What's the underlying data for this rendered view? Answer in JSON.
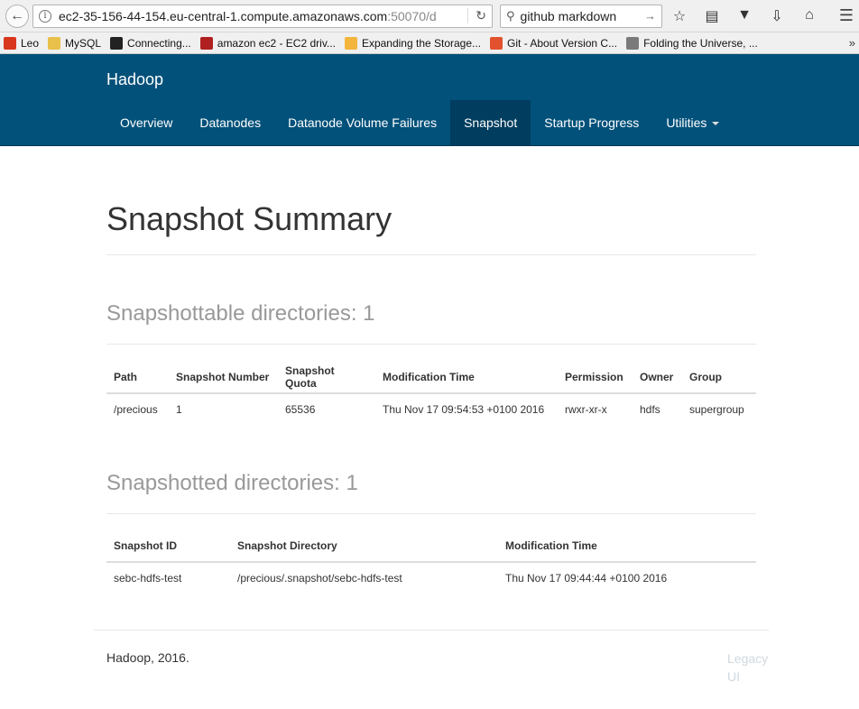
{
  "browser": {
    "url_host": "ec2-35-156-44-154.eu-central-1.compute.amazonaws.com",
    "url_rest": ":50070/d",
    "search_text": "github markdown",
    "bookmarks": [
      {
        "label": "Leo",
        "color": "#d9361e"
      },
      {
        "label": "MySQL",
        "color": "#e8c04a"
      },
      {
        "label": "Connecting...",
        "color": "#222222"
      },
      {
        "label": "amazon ec2 - EC2 driv...",
        "color": "#b02020"
      },
      {
        "label": "Expanding the Storage...",
        "color": "#f3b53b"
      },
      {
        "label": "Git - About Version C...",
        "color": "#e2522f"
      },
      {
        "label": "Folding the Universe, ...",
        "color": "#7a7a7a"
      }
    ],
    "bookmarks_more": "»"
  },
  "navbar": {
    "brand": "Hadoop",
    "items": [
      {
        "label": "Overview"
      },
      {
        "label": "Datanodes"
      },
      {
        "label": "Datanode Volume Failures"
      },
      {
        "label": "Snapshot"
      },
      {
        "label": "Startup Progress"
      },
      {
        "label": "Utilities"
      }
    ]
  },
  "page": {
    "title": "Snapshot Summary",
    "snapshottable_title": "Snapshottable directories: 1",
    "snapshottable_headers": [
      "Path",
      "Snapshot Number",
      "Snapshot Quota",
      "Modification Time",
      "Permission",
      "Owner",
      "Group"
    ],
    "snapshottable_rows": [
      [
        "/precious",
        "1",
        "65536",
        "Thu Nov 17 09:54:53 +0100 2016",
        "rwxr-xr-x",
        "hdfs",
        "supergroup"
      ]
    ],
    "snapshotted_title": "Snapshotted directories: 1",
    "snapshotted_headers": [
      "Snapshot ID",
      "Snapshot Directory",
      "Modification Time"
    ],
    "snapshotted_rows": [
      [
        "sebc-hdfs-test",
        "/precious/.snapshot/sebc-hdfs-test",
        "Thu Nov 17 09:44:44 +0100 2016"
      ]
    ]
  },
  "footer": {
    "text": "Hadoop, 2016.",
    "legacy_line1": "Legacy",
    "legacy_line2": "UI"
  }
}
